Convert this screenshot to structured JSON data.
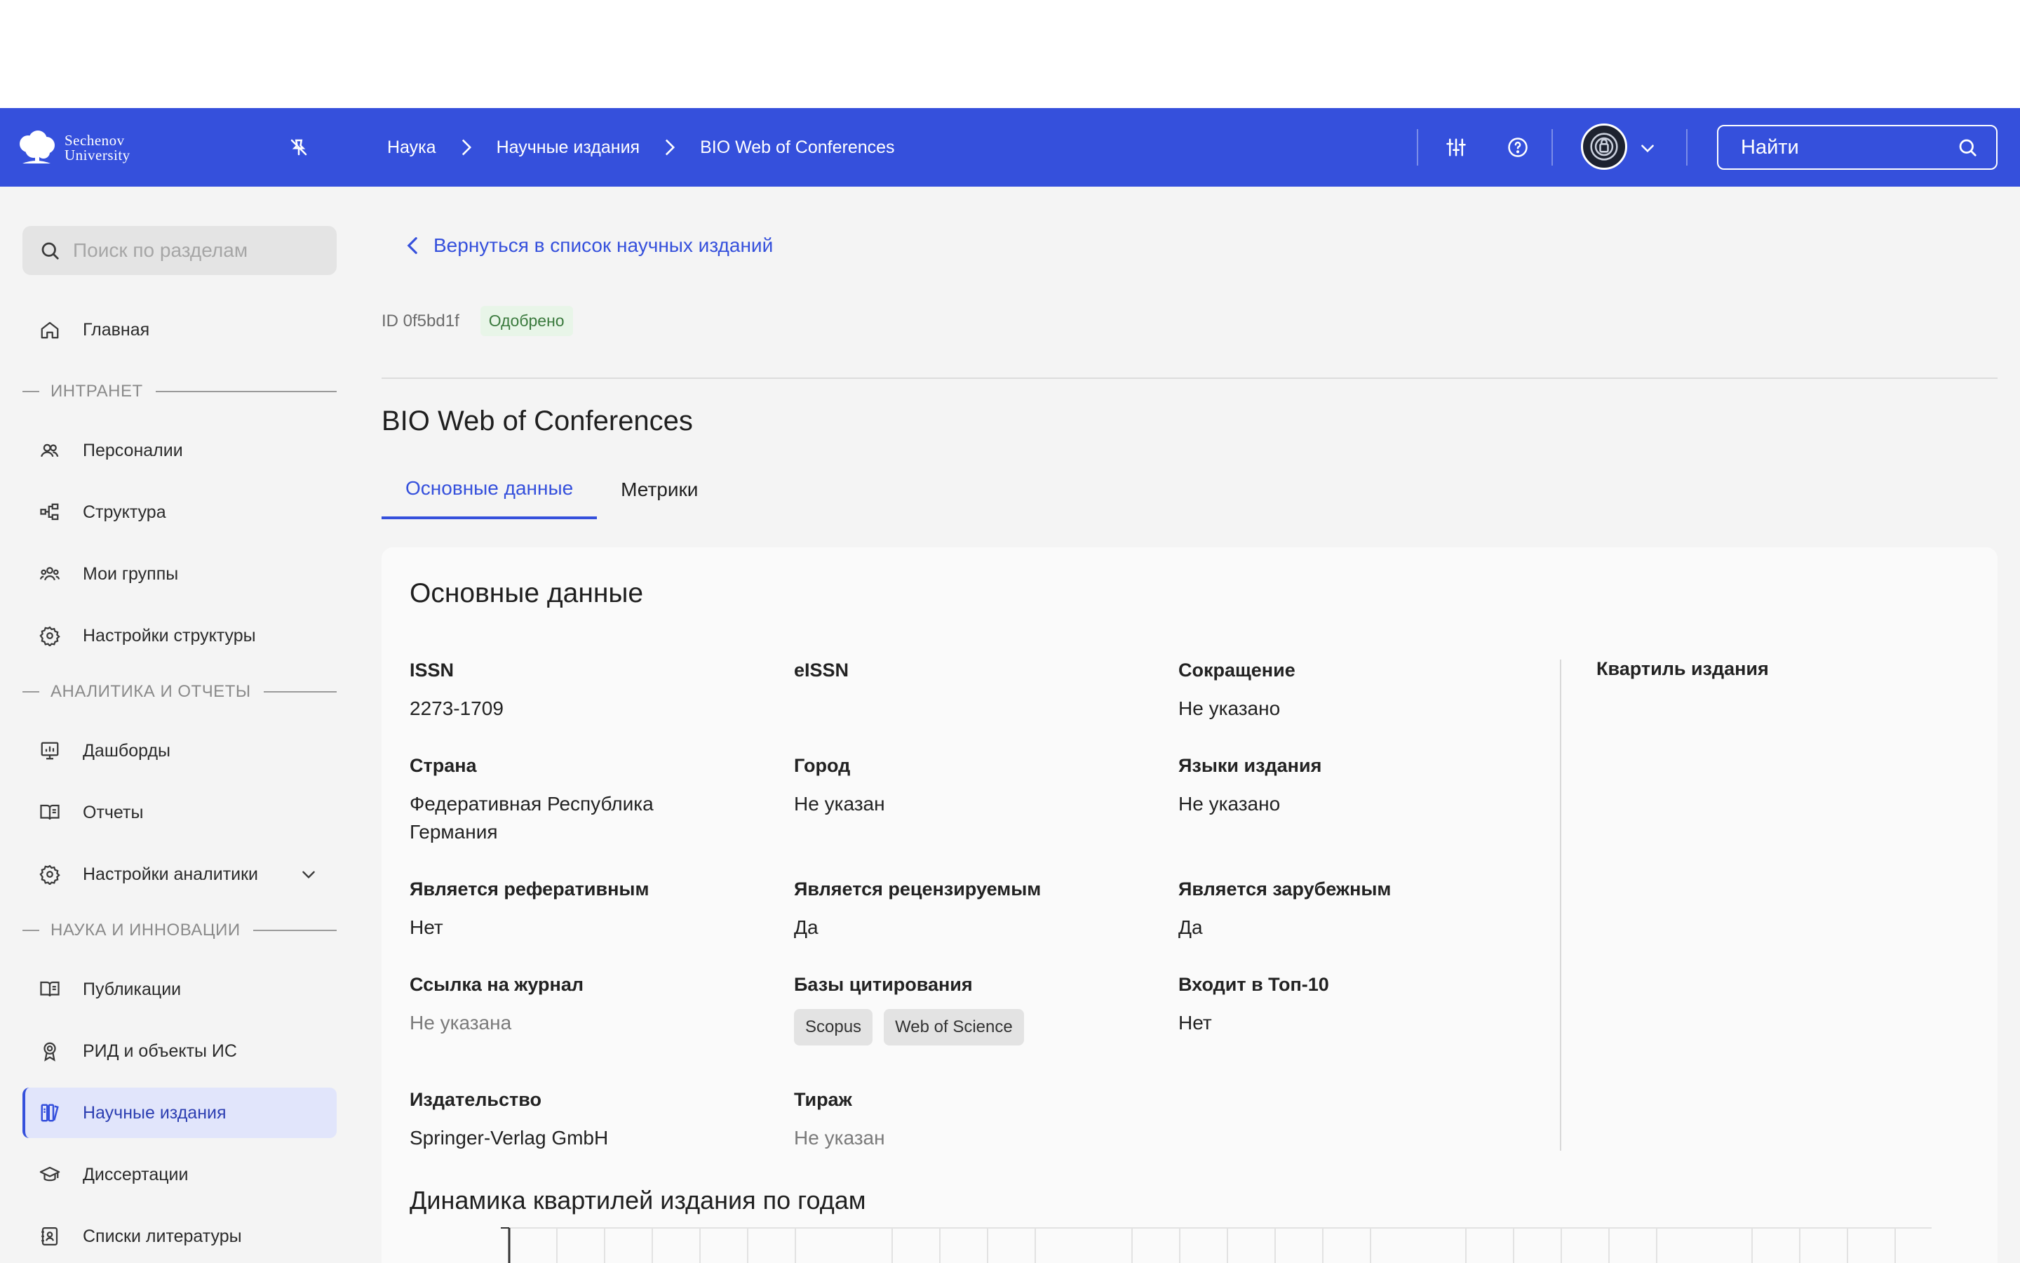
{
  "header": {
    "logo_line1": "Sechenov",
    "logo_line2": "University",
    "breadcrumbs": [
      "Наука",
      "Научные издания",
      "BIO Web of Conferences"
    ],
    "search_placeholder": "Найти",
    "brand_color": "#3550dc",
    "icons": [
      "pin-off-icon",
      "sliders-icon",
      "help-circle-icon",
      "avatar",
      "chevron-down-icon",
      "search-icon"
    ]
  },
  "sidebar": {
    "search_placeholder": "Поиск по разделам",
    "home_label": "Главная",
    "section_intranet": "ИНТРАНЕТ",
    "personalii": "Персоналии",
    "struktura": "Структура",
    "moi_gruppy": "Мои группы",
    "nastroiki_struktury": "Настройки структуры",
    "section_analytics": "АНАЛИТИКА И ОТЧЕТЫ",
    "dashboardy": "Дашборды",
    "otchety": "Отчеты",
    "nastroiki_analitiki": "Настройки аналитики",
    "section_science": "НАУКА И ИННОВАЦИИ",
    "publikacii": "Публикации",
    "rid": "РИД и объекты ИС",
    "nauchnye_izdaniya": "Научные издания",
    "dissertacii": "Диссертации",
    "spiski_literatury": "Списки литературы"
  },
  "main": {
    "back_link": "Вернуться в список научных изданий",
    "id_text": "ID 0f5bd1f",
    "status": "Одобрено",
    "title": "BIO Web of Conferences",
    "tabs": [
      "Основные данные",
      "Метрики"
    ],
    "card_title": "Основные данные",
    "fields": {
      "issn": {
        "label": "ISSN",
        "value": "2273-1709"
      },
      "eissn": {
        "label": "eISSN",
        "value": ""
      },
      "abbr": {
        "label": "Сокращение",
        "value": "Не указано"
      },
      "country": {
        "label": "Страна",
        "value": "Федеративная Республика Германия"
      },
      "city": {
        "label": "Город",
        "value": "Не указан"
      },
      "languages": {
        "label": "Языки издания",
        "value": "Не указано"
      },
      "abstracting": {
        "label": "Является реферативным",
        "value": "Нет"
      },
      "peer_reviewed": {
        "label": "Является рецензируемым",
        "value": "Да"
      },
      "foreign": {
        "label": "Является зарубежным",
        "value": "Да"
      },
      "link": {
        "label": "Ссылка на журнал",
        "value": "Не указана"
      },
      "citation_dbs": {
        "label": "Базы цитирования",
        "values": [
          "Scopus",
          "Web of Science"
        ]
      },
      "top10": {
        "label": "Входит в Топ-10",
        "value": "Нет"
      },
      "publisher": {
        "label": "Издательство",
        "value": "Springer-Verlag GmbH"
      },
      "circulation": {
        "label": "Тираж",
        "value": "Не указан"
      }
    },
    "quartile_label": "Квартиль издания",
    "dynamics_title": "Динамика квартилей издания по годам"
  }
}
